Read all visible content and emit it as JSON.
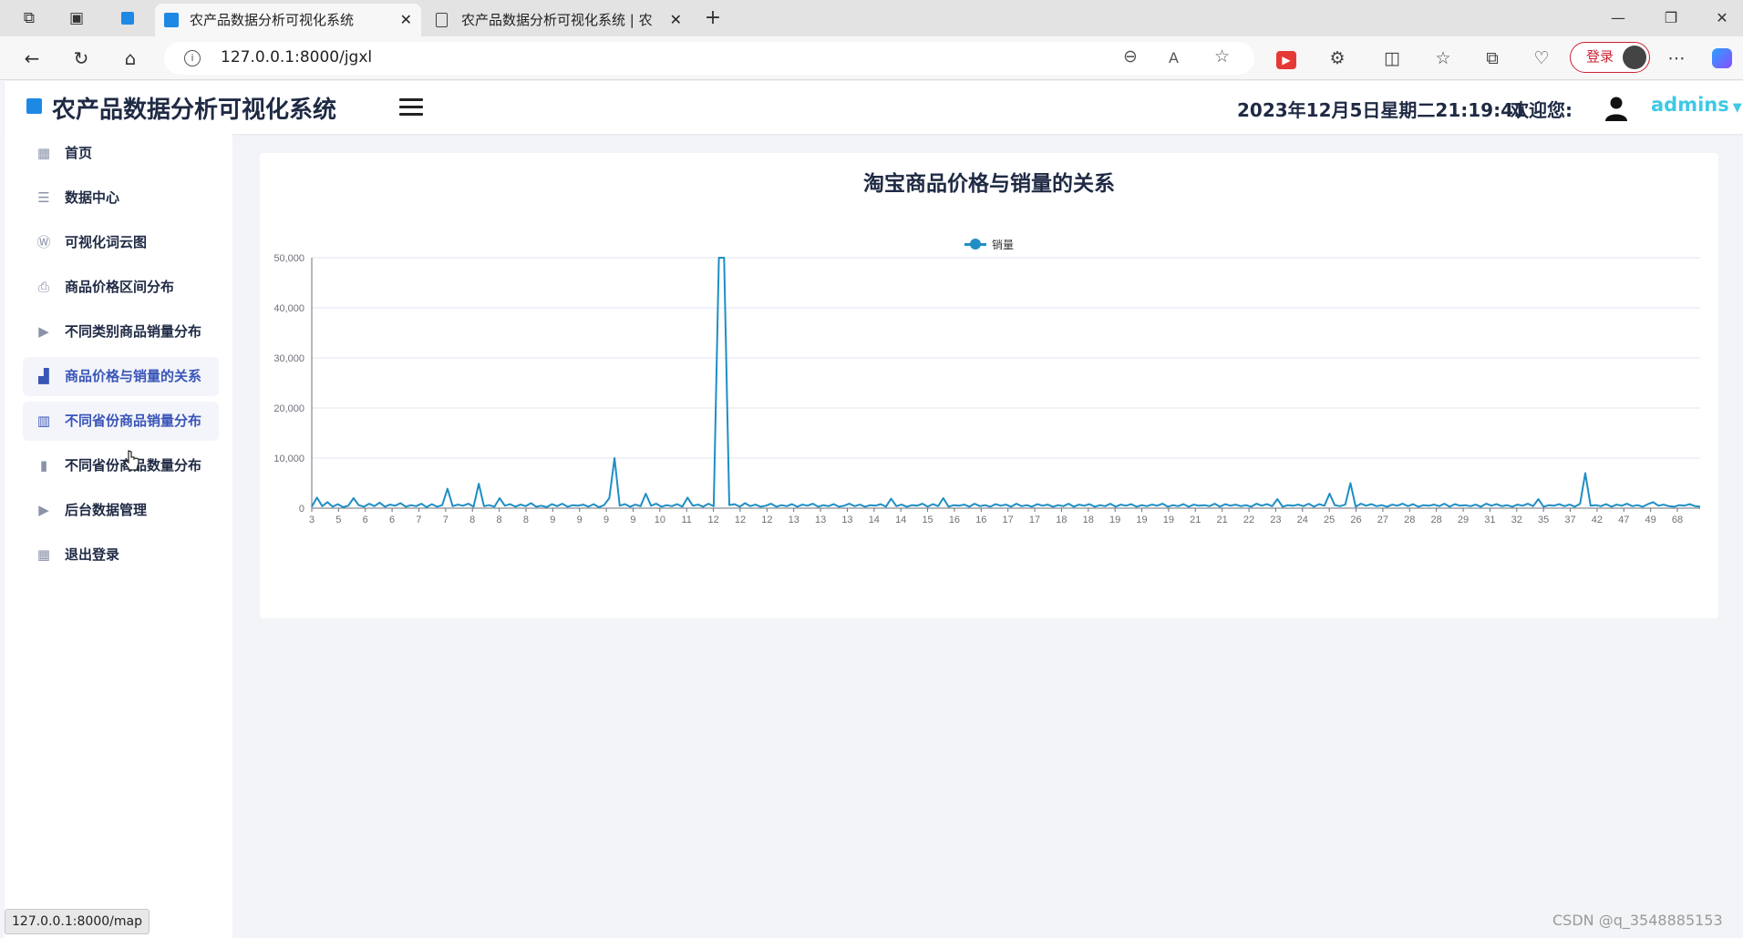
{
  "browser": {
    "tabs": [
      {
        "title": "农产品数据分析可视化系统",
        "active": true
      },
      {
        "title": "农产品数据分析可视化系统 | 农产",
        "active": false
      }
    ],
    "url": "127.0.0.1:8000/jgxl",
    "login_label": "登录"
  },
  "header": {
    "brand": "农产品数据分析可视化系统",
    "datetime": "2023年12月5日星期二21:19:41",
    "welcome": "欢迎您:",
    "username": "admins"
  },
  "sidebar": {
    "items": [
      {
        "label": "首页",
        "icon": "grid-icon"
      },
      {
        "label": "数据中心",
        "icon": "database-icon"
      },
      {
        "label": "可视化词云图",
        "icon": "wordpress-icon"
      },
      {
        "label": "商品价格区间分布",
        "icon": "printer-icon"
      },
      {
        "label": "不同类别商品销量分布",
        "icon": "play-icon"
      },
      {
        "label": "商品价格与销量的关系",
        "icon": "bar-chart-icon",
        "highlighted": true
      },
      {
        "label": "不同省份商品销量分布",
        "icon": "map-icon",
        "highlighted": true
      },
      {
        "label": "不同省份商品数量分布",
        "icon": "map-filled-icon"
      },
      {
        "label": "后台数据管理",
        "icon": "play-icon"
      },
      {
        "label": "退出登录",
        "icon": "grid-icon"
      }
    ]
  },
  "status_url": "127.0.0.1:8000/map",
  "watermark": "CSDN @q_3548885153",
  "colors": {
    "accent": "#1f8ec5",
    "brand_blue": "#1e88e5",
    "username": "#3ec9e6"
  },
  "chart_data": {
    "type": "line",
    "title": "淘宝商品价格与销量的关系",
    "legend": [
      "销量"
    ],
    "legend_position": "top-center",
    "series": [
      {
        "name": "销量",
        "values": [
          300,
          2100,
          400,
          1200,
          300,
          800,
          200,
          500,
          2000,
          600,
          300,
          900,
          400,
          1100,
          300,
          700,
          500,
          1000,
          300,
          600,
          400,
          900,
          200,
          800,
          300,
          600,
          3900,
          400,
          700,
          500,
          900,
          300,
          4900,
          400,
          600,
          300,
          2000,
          500,
          800,
          300,
          700,
          400,
          1000,
          300,
          500,
          200,
          800,
          400,
          900,
          300,
          600,
          500,
          700,
          300,
          800,
          200,
          600,
          2000,
          10000,
          500,
          800,
          300,
          700,
          400,
          2900,
          500,
          900,
          300,
          600,
          400,
          800,
          300,
          2100,
          500,
          700,
          300,
          900,
          400,
          50000,
          50000,
          600,
          800,
          300,
          1000,
          400,
          700,
          300,
          500,
          900,
          300,
          600,
          400,
          800,
          300,
          700,
          500,
          900,
          300,
          600,
          400,
          800,
          300,
          500,
          900,
          400,
          700,
          300,
          600,
          500,
          800,
          300,
          1900,
          400,
          700,
          300,
          600,
          500,
          900,
          300,
          800,
          400,
          2000,
          300,
          600,
          500,
          700,
          300,
          900,
          400,
          600,
          300,
          800,
          500,
          700,
          300,
          900,
          400,
          600,
          300,
          800,
          500,
          700,
          300,
          600,
          400,
          900,
          300,
          700,
          500,
          800,
          300,
          600,
          400,
          900,
          300,
          700,
          500,
          800,
          300,
          600,
          400,
          700,
          500,
          900,
          300,
          600,
          400,
          800,
          300,
          700,
          500,
          600,
          400,
          900,
          300,
          800,
          500,
          700,
          400,
          600,
          300,
          900,
          500,
          800,
          400,
          1800,
          300,
          600,
          500,
          700,
          400,
          900,
          300,
          800,
          500,
          2900,
          600,
          400,
          700,
          5000,
          300,
          900,
          500,
          800,
          400,
          600,
          300,
          700,
          500,
          900,
          400,
          800,
          300,
          600,
          500,
          700,
          400,
          900,
          300,
          800,
          500,
          600,
          400,
          700,
          300,
          900,
          500,
          800,
          400,
          600,
          300,
          700,
          500,
          900,
          400,
          1800,
          300,
          600,
          500,
          800,
          400,
          700,
          300,
          900,
          7000,
          500,
          600,
          400,
          800,
          300,
          700,
          500,
          900,
          400,
          600,
          300,
          800,
          1200,
          500,
          700,
          400,
          300,
          600,
          500,
          800,
          400,
          300
        ]
      }
    ],
    "x_tick_labels": [
      "3",
      "5",
      "6",
      "6",
      "7",
      "7",
      "8",
      "8",
      "8",
      "9",
      "9",
      "9",
      "9",
      "10",
      "11",
      "12",
      "12",
      "12",
      "13",
      "13",
      "13",
      "14",
      "14",
      "15",
      "16",
      "16",
      "17",
      "17",
      "18",
      "18",
      "19",
      "19",
      "19",
      "21",
      "21",
      "22",
      "23",
      "24",
      "25",
      "26",
      "27",
      "28",
      "28",
      "29",
      "31",
      "32",
      "35",
      "37",
      "42",
      "47",
      "49",
      "68"
    ],
    "xlabel": "",
    "ylabel": "",
    "ylim": [
      0,
      50000
    ],
    "y_ticks": [
      "0",
      "10,000",
      "20,000",
      "30,000",
      "40,000",
      "50,000"
    ],
    "grid": true
  }
}
